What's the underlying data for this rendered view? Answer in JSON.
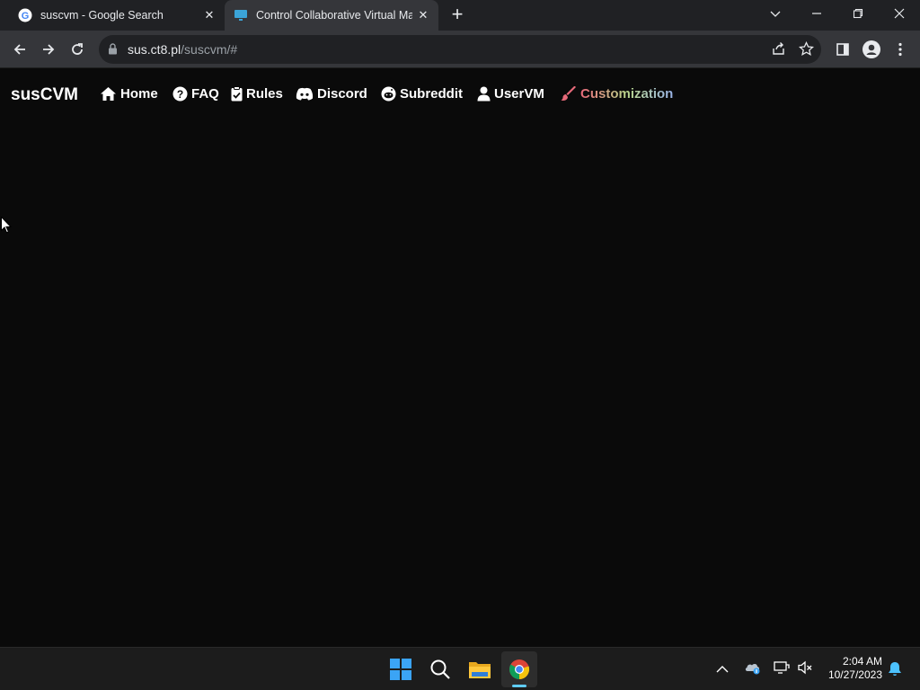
{
  "browser": {
    "tabs": [
      {
        "title": "suscvm - Google Search",
        "icon": "google-icon",
        "active": false
      },
      {
        "title": "Control Collaborative Virtual Mac",
        "icon": "monitor-icon",
        "active": true
      }
    ],
    "new_tab_label": "+",
    "url_host": "sus.ct8.pl",
    "url_path": "/suscvm/#"
  },
  "site": {
    "brand": "susCVM",
    "nav": [
      {
        "label": "Home",
        "icon": "home-icon"
      },
      {
        "label": "FAQ",
        "icon": "question-icon"
      },
      {
        "label": "Rules",
        "icon": "clipboard-icon"
      },
      {
        "label": "Discord",
        "icon": "discord-icon"
      },
      {
        "label": "Subreddit",
        "icon": "reddit-icon"
      },
      {
        "label": "UserVM",
        "icon": "user-icon"
      },
      {
        "label": "Customization",
        "icon": "brush-icon"
      }
    ],
    "colors": {
      "background": "#0a0a0a",
      "customization_gradient": [
        "#e86a7a",
        "#b8d48a",
        "#9ab4e8"
      ]
    }
  },
  "taskbar": {
    "time": "2:04 AM",
    "date": "10/27/2023"
  }
}
